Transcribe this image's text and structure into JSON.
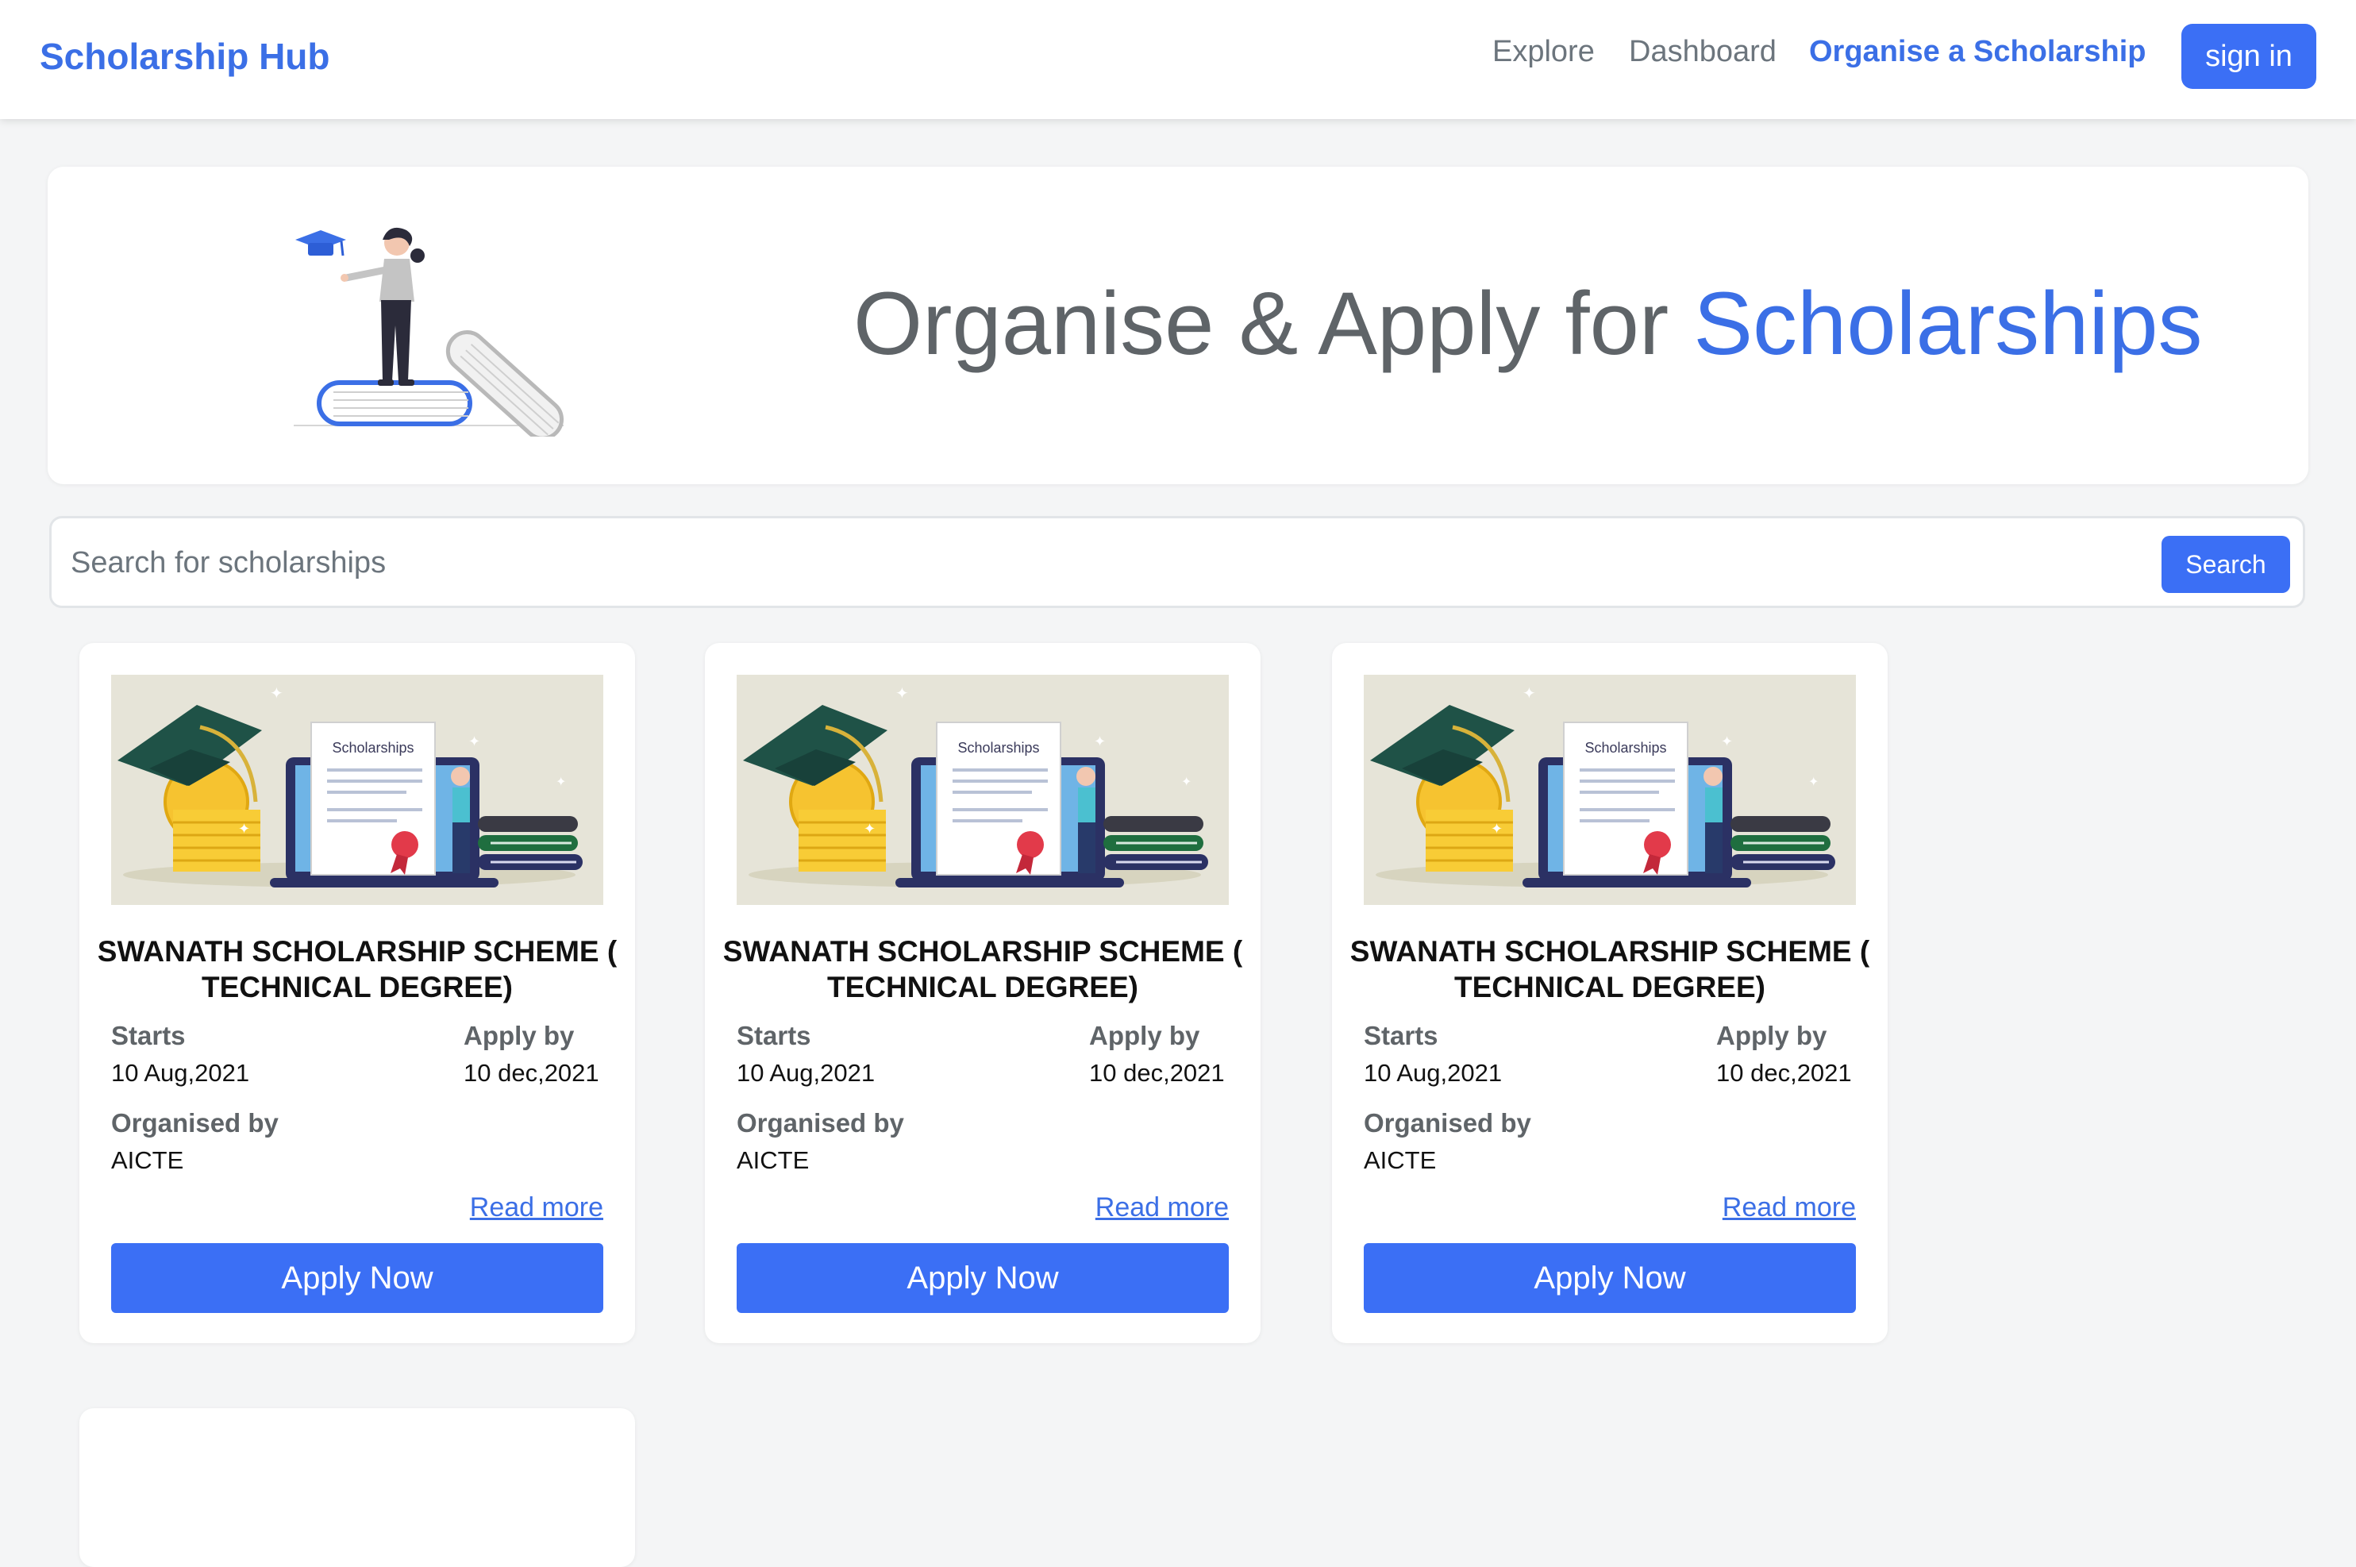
{
  "nav": {
    "brand": "Scholarship Hub",
    "links": [
      "Explore",
      "Dashboard",
      "Organise a Scholarship"
    ],
    "signin_label": "sign in",
    "accent_color": "#3b6fe6"
  },
  "hero": {
    "title_main": "Organise & Apply for ",
    "title_accent": "Scholarships"
  },
  "search": {
    "placeholder": "Search for scholarships",
    "button_label": "Search"
  },
  "cards": [
    {
      "image_label": "Scholarships",
      "title": "SWANATH SCHOLARSHIP SCHEME ( TECHNICAL DEGREE)",
      "starts_label": "Starts",
      "starts": "10 Aug,2021",
      "apply_by_label": "Apply by",
      "apply_by": "10 dec,2021",
      "organised_by_label": "Organised by",
      "organised_by": "AICTE",
      "read_more": "Read more",
      "apply_label": "Apply Now"
    },
    {
      "image_label": "Scholarships",
      "title": "SWANATH SCHOLARSHIP SCHEME ( TECHNICAL DEGREE)",
      "starts_label": "Starts",
      "starts": "10 Aug,2021",
      "apply_by_label": "Apply by",
      "apply_by": "10 dec,2021",
      "organised_by_label": "Organised by",
      "organised_by": "AICTE",
      "read_more": "Read more",
      "apply_label": "Apply Now"
    },
    {
      "image_label": "Scholarships",
      "title": "SWANATH SCHOLARSHIP SCHEME ( TECHNICAL DEGREE)",
      "starts_label": "Starts",
      "starts": "10 Aug,2021",
      "apply_by_label": "Apply by",
      "apply_by": "10 dec,2021",
      "organised_by_label": "Organised by",
      "organised_by": "AICTE",
      "read_more": "Read more",
      "apply_label": "Apply Now"
    }
  ]
}
